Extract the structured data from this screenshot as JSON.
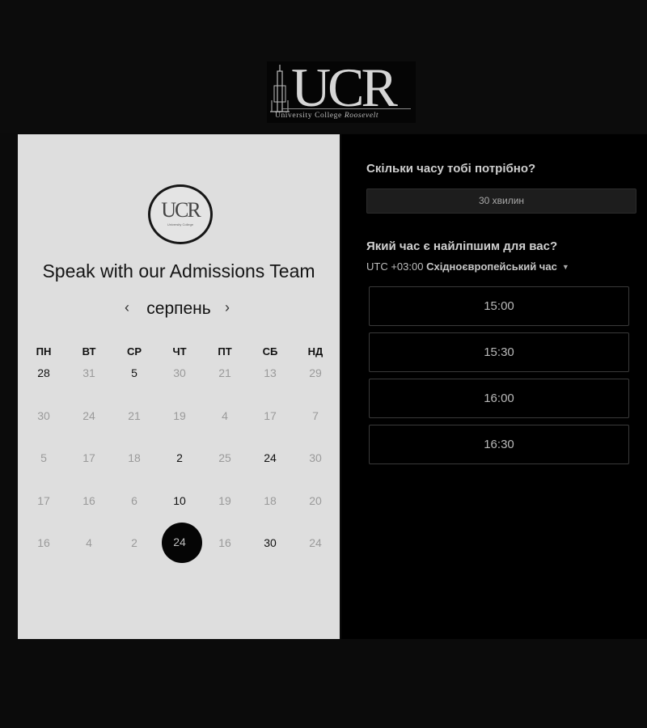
{
  "top_logo": {
    "mark": "UCR",
    "subtitle_regular": "University College ",
    "subtitle_italic": "Roosevelt"
  },
  "calendar": {
    "badge_mark": "UCR",
    "title": "Speak with our Admissions Team",
    "month": "серпень",
    "prev_icon": "‹",
    "next_icon": "›",
    "weekdays": [
      "ПН",
      "ВТ",
      "СР",
      "ЧТ",
      "ПТ",
      "СБ",
      "НД"
    ],
    "weeks": [
      [
        {
          "d": "28",
          "a": true
        },
        {
          "d": "31",
          "a": false
        },
        {
          "d": "5",
          "a": true
        },
        {
          "d": "30",
          "a": false
        },
        {
          "d": "21",
          "a": false
        },
        {
          "d": "13",
          "a": false
        },
        {
          "d": "29",
          "a": false
        }
      ],
      [
        {
          "d": "30",
          "a": false
        },
        {
          "d": "24",
          "a": false
        },
        {
          "d": "21",
          "a": false
        },
        {
          "d": "19",
          "a": false
        },
        {
          "d": "4",
          "a": false
        },
        {
          "d": "17",
          "a": false
        },
        {
          "d": "7",
          "a": false
        }
      ],
      [
        {
          "d": "5",
          "a": false
        },
        {
          "d": "17",
          "a": false
        },
        {
          "d": "18",
          "a": false
        },
        {
          "d": "2",
          "a": true
        },
        {
          "d": "25",
          "a": false
        },
        {
          "d": "24",
          "a": true
        },
        {
          "d": "30",
          "a": false
        }
      ],
      [
        {
          "d": "17",
          "a": false
        },
        {
          "d": "16",
          "a": false
        },
        {
          "d": "6",
          "a": false
        },
        {
          "d": "10",
          "a": true
        },
        {
          "d": "19",
          "a": false
        },
        {
          "d": "18",
          "a": false
        },
        {
          "d": "20",
          "a": false
        }
      ],
      [
        {
          "d": "16",
          "a": false
        },
        {
          "d": "4",
          "a": false
        },
        {
          "d": "2",
          "a": false
        },
        {
          "d": "24",
          "a": true,
          "selected": true
        },
        {
          "d": "16",
          "a": false
        },
        {
          "d": "30",
          "a": true
        },
        {
          "d": "24",
          "a": false
        }
      ]
    ]
  },
  "booking": {
    "duration_question": "Скільки часу тобі потрібно?",
    "duration_value": "30 хвилин",
    "time_question": "Який час є найліпшим для вас?",
    "tz_offset": "UTC +03:00 ",
    "tz_name": "Східноєвропейський час",
    "tz_caret": "▼",
    "slots": [
      "15:00",
      "15:30",
      "16:00",
      "16:30"
    ]
  },
  "colors": {
    "background": "#0b0b0b",
    "calendar_panel": "#dedede",
    "selected_day": "#050505"
  }
}
